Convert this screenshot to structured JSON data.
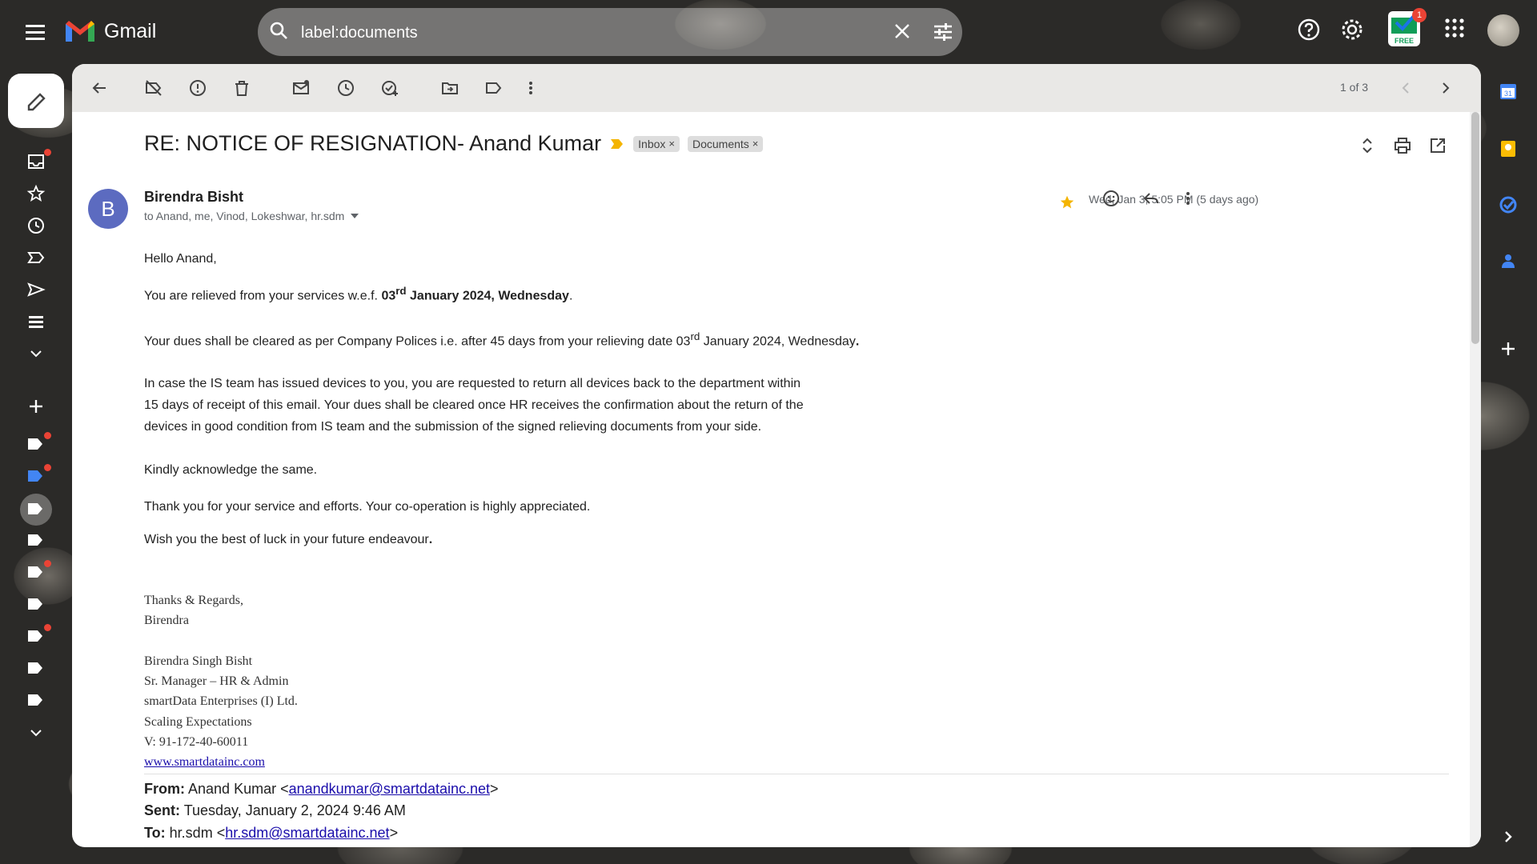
{
  "app": {
    "name": "Gmail"
  },
  "search": {
    "value": "label:documents"
  },
  "topbar": {
    "badge_label": "FREE",
    "notification_count": "1"
  },
  "toolbar": {
    "pager": "1 of 3"
  },
  "email": {
    "subject": "RE: NOTICE OF RESIGNATION- Anand Kumar",
    "labels": [
      "Inbox",
      "Documents"
    ],
    "label_remove": "×",
    "sender_initial": "B",
    "sender_name": "Birendra Bisht",
    "recipients": "to Anand, me, Vinod, Lokeshwar, hr.sdm",
    "date": "Wed, Jan 3, 5:05 PM (5 days ago)",
    "starred": true,
    "greeting": "Hello Anand,",
    "p1_a": "You are relieved from your services w.e.f. ",
    "p1_b": "03",
    "p1_sup": "rd",
    "p1_c": " January 2024, Wednesday",
    "p1_d": ".",
    "p2_a": "Your dues shall be cleared as per Company Polices i.e. after 45 days from your relieving date 03",
    "p2_sup": "rd",
    "p2_b": " January 2024, Wednesday",
    "p2_c": ".",
    "p3_l1": "In case the IS team has issued devices to you, you are requested to return all devices back to the department within",
    "p3_l2": "15 days of receipt of this email. Your dues shall be cleared once HR receives the confirmation about the return of the",
    "p3_l3": "devices in good condition from IS team and the submission of the signed relieving documents from your side.",
    "p4": "Kindly acknowledge the same.",
    "p5": "Thank you for your service and efforts. Your co-operation is highly appreciated.",
    "p6_a": "Wish you the best of luck in your future endeavour",
    "p6_b": ".",
    "signature": {
      "closing": "Thanks & Regards,",
      "first_name": "Birendra",
      "full_name": "Birendra Singh Bisht",
      "title": "Sr. Manager – HR & Admin",
      "company": "smartData Enterprises (I) Ltd.",
      "tagline": "Scaling Expectations",
      "phone": "V: 91-172-40-60011",
      "website": "www.smartdatainc.com"
    },
    "quoted": {
      "from_label": "From:",
      "from_name": "Anand Kumar <",
      "from_email": "anandkumar@smartdatainc.net",
      "from_close": ">",
      "sent_label": "Sent:",
      "sent_value": "Tuesday, January 2, 2024 9:46 AM",
      "to_label": "To:",
      "to_name": "hr.sdm <",
      "to_email": "hr.sdm@smartdatainc.net",
      "to_close": ">"
    }
  },
  "colors": {
    "accent": "#1a73e8",
    "avatar": "#5c6bc0",
    "star": "#f4b400",
    "notification": "#ea4335"
  }
}
